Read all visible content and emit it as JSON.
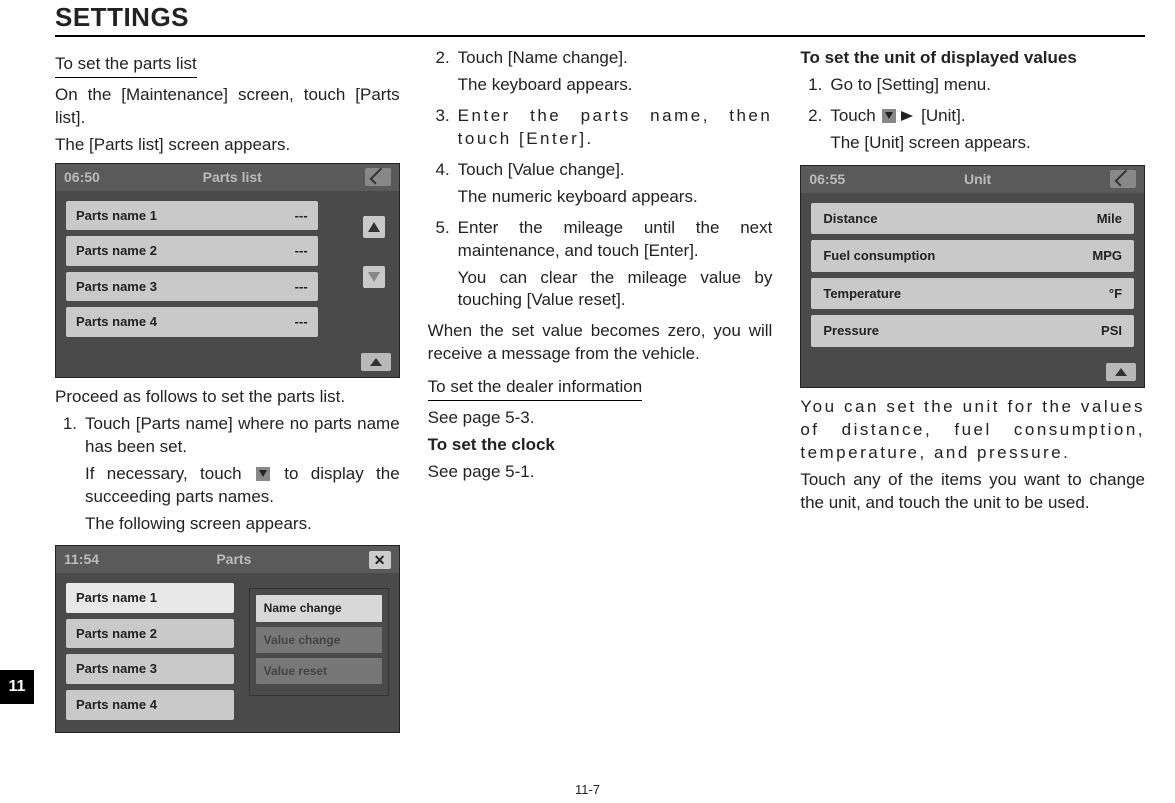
{
  "page": {
    "title": "SETTINGS",
    "chapter_tab": "11",
    "page_number": "11-7"
  },
  "col1": {
    "heading": "To set the parts list",
    "p1": "On the [Maintenance] screen, touch [Parts list].",
    "p2": "The [Parts list] screen appears.",
    "screen1": {
      "time": "06:50",
      "title": "Parts list",
      "rows": [
        {
          "name": "Parts name 1",
          "val": "---"
        },
        {
          "name": "Parts name 2",
          "val": "---"
        },
        {
          "name": "Parts name 3",
          "val": "---"
        },
        {
          "name": "Parts name 4",
          "val": "---"
        }
      ]
    },
    "p3": "Proceed as follows to set the parts list.",
    "step1_a": "Touch [Parts name] where no parts name has been set.",
    "step1_b1": "If necessary, touch ",
    "step1_b2": " to display the succeeding parts names.",
    "step1_c": "The following screen appears.",
    "screen2": {
      "time": "11:54",
      "title": "Parts",
      "rows": [
        "Parts name 1",
        "Parts name 2",
        "Parts name 3",
        "Parts name 4"
      ],
      "popup": [
        "Name change",
        "Value change",
        "Value reset"
      ]
    }
  },
  "col2": {
    "step2_a": "Touch [Name change].",
    "step2_b": "The keyboard appears.",
    "step3": "Enter the parts name, then touch [Enter].",
    "step4_a": "Touch [Value change].",
    "step4_b": "The numeric keyboard appears.",
    "step5_a": "Enter the mileage until the next maintenance, and touch [Enter].",
    "step5_b": "You can clear the mileage value by touching [Value reset].",
    "para": "When the set value becomes zero, you will receive a message from the vehicle.",
    "dealer_head": "To set the dealer information",
    "dealer_body": "See page 5-3.",
    "clock_head": "To set the clock",
    "clock_body": "See page 5-1."
  },
  "col3": {
    "heading": "To set the unit of displayed values",
    "step1": "Go to [Setting] menu.",
    "step2_a": "Touch ",
    "step2_b": " [Unit].",
    "step2_c": "The [Unit] screen appears.",
    "screen": {
      "time": "06:55",
      "title": "Unit",
      "rows": [
        {
          "name": "Distance",
          "val": "Mile"
        },
        {
          "name": "Fuel consumption",
          "val": "MPG"
        },
        {
          "name": "Temperature",
          "val": "°F"
        },
        {
          "name": "Pressure",
          "val": "PSI"
        }
      ]
    },
    "p1": "You can set the unit for the values of distance, fuel consumption, temperature, and pressure.",
    "p2": "Touch any of the items you want to change the unit, and touch the unit to be used."
  }
}
